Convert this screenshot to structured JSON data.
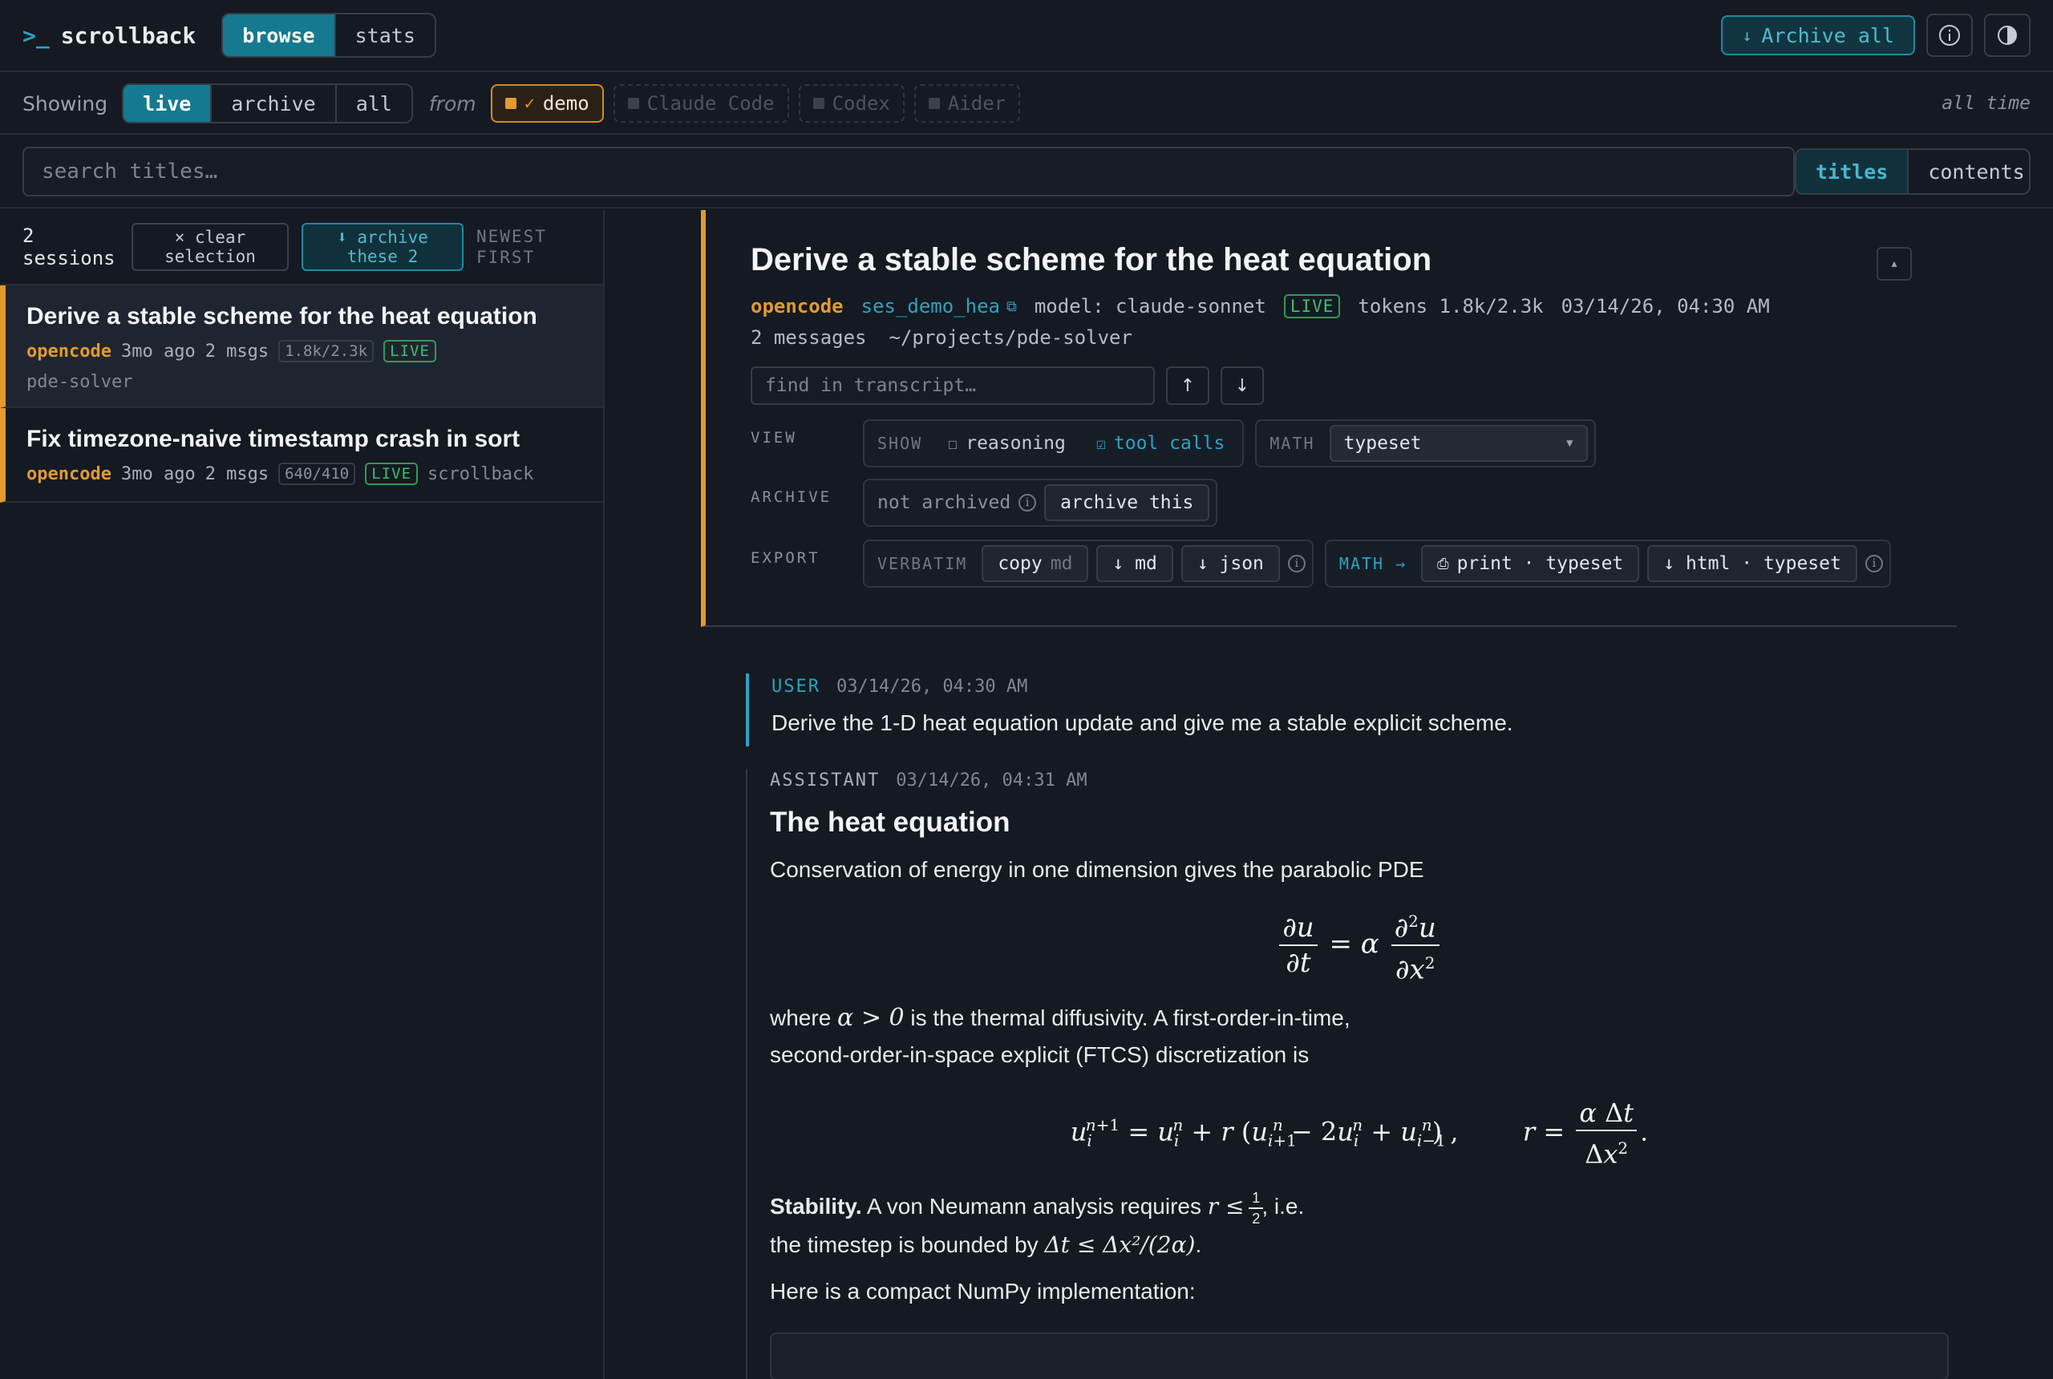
{
  "app": {
    "prompt": ">_",
    "name": "scrollback",
    "tabs": [
      {
        "label": "browse",
        "active": true
      },
      {
        "label": "stats",
        "active": false
      }
    ],
    "archive_all_label": "Archive all",
    "archive_all_icon": "↓"
  },
  "filter": {
    "showing_label": "Showing",
    "scopes": [
      {
        "label": "live",
        "active": true
      },
      {
        "label": "archive"
      },
      {
        "label": "all"
      }
    ],
    "from_label": "from",
    "sources": [
      {
        "label": "demo",
        "enabled": true,
        "check": "✓"
      },
      {
        "label": "Claude Code",
        "enabled": false
      },
      {
        "label": "Codex",
        "enabled": false
      },
      {
        "label": "Aider",
        "enabled": false
      }
    ],
    "time_range": "all time"
  },
  "search": {
    "placeholder": "search titles…",
    "value": "",
    "modes": [
      {
        "label": "titles",
        "active": true
      },
      {
        "label": "contents"
      }
    ]
  },
  "list": {
    "count_line1": "2",
    "count_line2": "sessions",
    "clear_line1": "× clear",
    "clear_line2": "selection",
    "archive_line1": "⬇ archive",
    "archive_line2": "these 2",
    "sort_line1": "NEWEST",
    "sort_line2": "FIRST",
    "sessions": [
      {
        "title": "Derive a stable scheme for the heat equation",
        "agent": "opencode",
        "age": "3mo ago",
        "msgs": "2 msgs",
        "tokens": "1.8k/2.3k",
        "status": "LIVE",
        "project": "pde-solver"
      },
      {
        "title": "Fix timezone-naive timestamp crash in sort",
        "agent": "opencode",
        "age": "3mo ago",
        "msgs": "2 msgs",
        "tokens": "640/410",
        "status": "LIVE",
        "project": "scrollback"
      }
    ]
  },
  "detail": {
    "title": "Derive a stable scheme for the heat equation",
    "agent": "opencode",
    "session_id": "ses_demo_hea",
    "model": "model: claude-sonnet",
    "status": "LIVE",
    "tokens": "tokens 1.8k/2.3k",
    "timestamp": "03/14/26, 04:30 AM",
    "messages": "2 messages",
    "path": "~/projects/pde-solver",
    "find_placeholder": "find in transcript…",
    "up_label": "↑",
    "down_label": "↓",
    "collapse_label": "▴",
    "view_label": "VIEW",
    "show_caption": "SHOW",
    "reasoning_label": "reasoning",
    "reasoning_checked": false,
    "tool_calls_label": "tool calls",
    "tool_calls_checked": true,
    "math_caption": "MATH",
    "math_mode": "typeset",
    "archive_label": "ARCHIVE",
    "archive_status": "not archived",
    "archive_btn": "archive this",
    "export_label": "EXPORT",
    "verbatim_caption": "VERBATIM",
    "copy_label": "copy",
    "copy_fmt": "md",
    "md_label": "↓ md",
    "json_label": "↓ json",
    "math_export_caption": "MATH →",
    "print_label": "print · typeset",
    "html_label": "↓ html · typeset"
  },
  "transcript": {
    "user": {
      "role": "USER",
      "time": "03/14/26, 04:30 AM",
      "text": "Derive the 1-D heat equation update and give me a stable explicit scheme."
    },
    "assistant": {
      "role": "ASSISTANT",
      "time": "03/14/26, 04:31 AM",
      "heading": "The heat equation",
      "p1": "Conservation of energy in one dimension gives the parabolic PDE",
      "p2_a": "where",
      "p2_math": "α > 0",
      "p2_b": "is the thermal diffusivity. A first-order-in-time,",
      "p2_c": "second-order-in-space explicit (FTCS) discretization is",
      "stab_bold": "Stability.",
      "stab_a": "A von Neumann analysis requires",
      "stab_math": "r ≤",
      "stab_b": ", i.e.",
      "stab_c": "the timestep is bounded by",
      "stab_math2": "Δt ≤ Δx²/(2α)",
      "p4": "Here is a compact NumPy implementation:"
    }
  },
  "colors": {
    "accent_teal": "#157a90",
    "agent_orange": "#e39a2e",
    "live_green": "#3fbf6f",
    "background": "#141922"
  },
  "icons": [
    "terminal-prompt-icon",
    "download-icon",
    "info-icon",
    "contrast-icon",
    "copy-icon",
    "printer-icon",
    "chevron-down-icon",
    "checkbox-icon"
  ]
}
